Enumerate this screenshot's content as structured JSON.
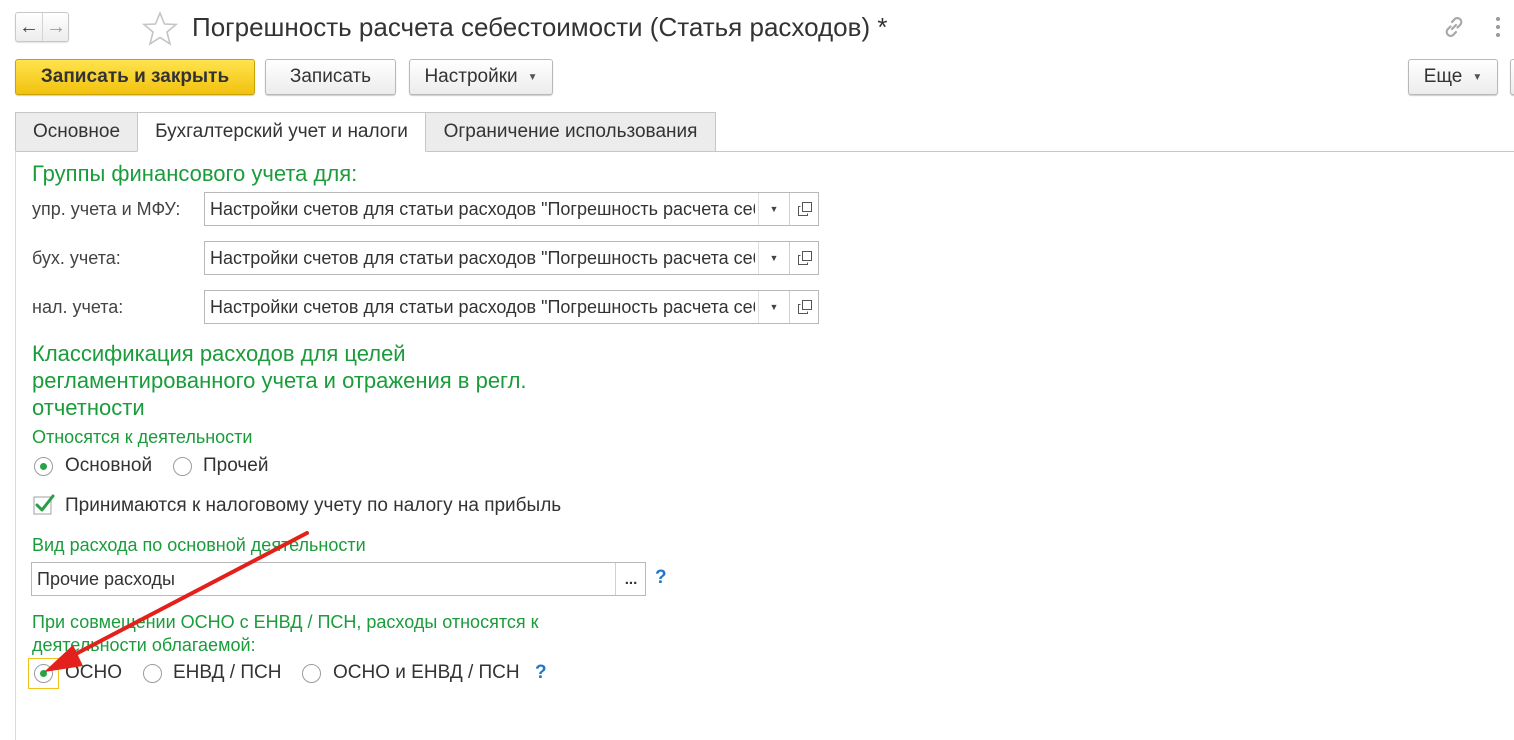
{
  "window": {
    "title": "Погрешность расчета себестоимости (Статья расходов) *",
    "back_icon": "arrow-left-icon",
    "forward_icon": "arrow-right-icon",
    "favorite_icon": "star-icon",
    "link_icon": "link-icon",
    "menu_icon": "more-vertical-icon"
  },
  "toolbar": {
    "save_close_label": "Записать и закрыть",
    "save_label": "Записать",
    "settings_label": "Настройки",
    "more_label": "Еще"
  },
  "tabs": [
    {
      "label": "Основное",
      "active": false
    },
    {
      "label": "Бухгалтерский учет и налоги",
      "active": true
    },
    {
      "label": "Ограничение использования",
      "active": false
    }
  ],
  "groups": {
    "heading": "Группы финансового учета для:",
    "rows": [
      {
        "label": "упр. учета и МФУ:",
        "value": "Настройки счетов для статьи расходов \"Погрешность расчета себестоимости\""
      },
      {
        "label": "бух. учета:",
        "value": "Настройки счетов для статьи расходов \"Погрешность расчета себестоимости\""
      },
      {
        "label": "нал. учета:",
        "value": "Настройки счетов для статьи расходов \"Погрешность расчета себестоимости\""
      }
    ]
  },
  "classification": {
    "heading_line1": "Классификация расходов для целей",
    "heading_line2": "регламентированного учета и отражения в регл.",
    "heading_line3": "отчетности",
    "activity_label": "Относятся к деятельности",
    "activity_options": [
      {
        "label": "Основной",
        "selected": true
      },
      {
        "label": "Прочей",
        "selected": false
      }
    ],
    "tax_checkbox_label": "Принимаются к налоговому учету по налогу на прибыль",
    "tax_checkbox_checked": true,
    "expense_type_label": "Вид расхода по основной деятельности",
    "expense_type_value": "Прочие расходы",
    "expense_type_button": "...",
    "help_mark": "?",
    "combined_label_line1": "При совмещении ОСНО с ЕНВД / ПСН, расходы относятся к",
    "combined_label_line2": "деятельности облагаемой:",
    "combined_options": [
      {
        "label": "ОСНО",
        "selected": true
      },
      {
        "label": "ЕНВД / ПСН",
        "selected": false
      },
      {
        "label": "ОСНО и ЕНВД / ПСН",
        "selected": false
      }
    ]
  },
  "colors": {
    "accent_green": "#1a9c3b",
    "primary_button": "#f2c20f",
    "annotation_arrow": "#e3201b",
    "help_blue": "#1f77c6"
  }
}
